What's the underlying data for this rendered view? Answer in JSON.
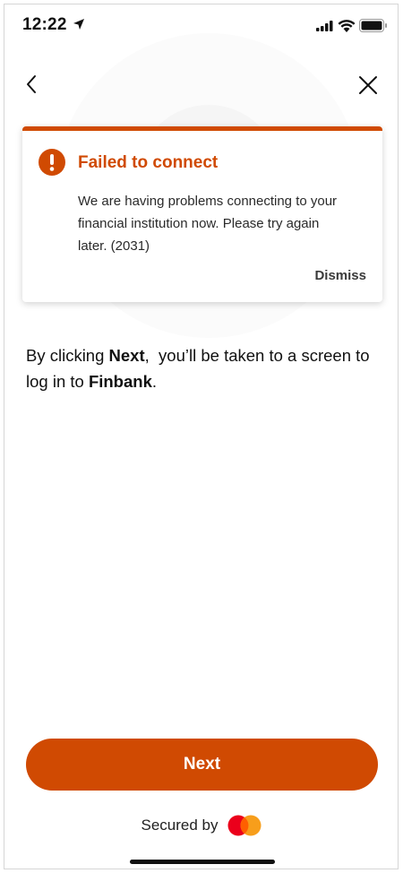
{
  "status_bar": {
    "time": "12:22"
  },
  "nav": {
    "back_icon": "chevron-left-icon",
    "close_icon": "close-icon"
  },
  "error": {
    "title": "Failed to connect",
    "message": "We are having problems connecting to your financial institution now. Please try again later. (2031)",
    "dismiss_label": "Dismiss",
    "icon": "exclamation-icon",
    "accent_color": "#d04a02"
  },
  "info": {
    "prefix": "By clicking ",
    "next_word": "Next",
    "middle": ",  you’ll be taken to a screen to log in to ",
    "bank_name": "Finbank",
    "suffix": "."
  },
  "next_button": {
    "label": "Next",
    "color": "#d04a02"
  },
  "footer": {
    "secured_label": "Secured by",
    "logo": "mastercard-logo"
  }
}
